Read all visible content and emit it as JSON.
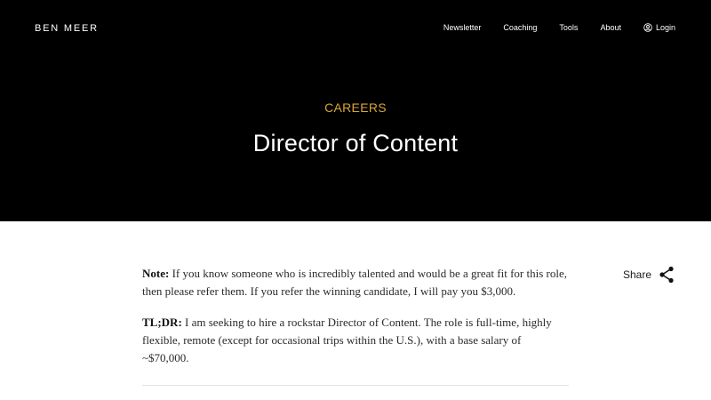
{
  "header": {
    "brand": "BEN MEER",
    "nav": [
      {
        "label": "Newsletter"
      },
      {
        "label": "Coaching"
      },
      {
        "label": "Tools"
      },
      {
        "label": "About"
      },
      {
        "label": "Login",
        "icon": "user-circle-icon"
      }
    ]
  },
  "hero": {
    "eyebrow": "CAREERS",
    "title": "Director of Content"
  },
  "article": {
    "note_label": "Note:",
    "note_text": " If you know someone who is incredibly talented and would be a great fit for this role, then please refer them. If you refer the winning candidate, I will pay you $3,000.",
    "tldr_label": "TL;DR:",
    "tldr_text": " I am seeking to hire a rockstar Director of Content. The role is full-time, highly flexible, remote (except for occasional trips within the U.S.), with a base salary of ~$70,000."
  },
  "share": {
    "label": "Share",
    "icon": "share-icon"
  },
  "colors": {
    "hero_bg": "#000000",
    "accent": "#d6a53a",
    "text": "#2a2a2a"
  }
}
